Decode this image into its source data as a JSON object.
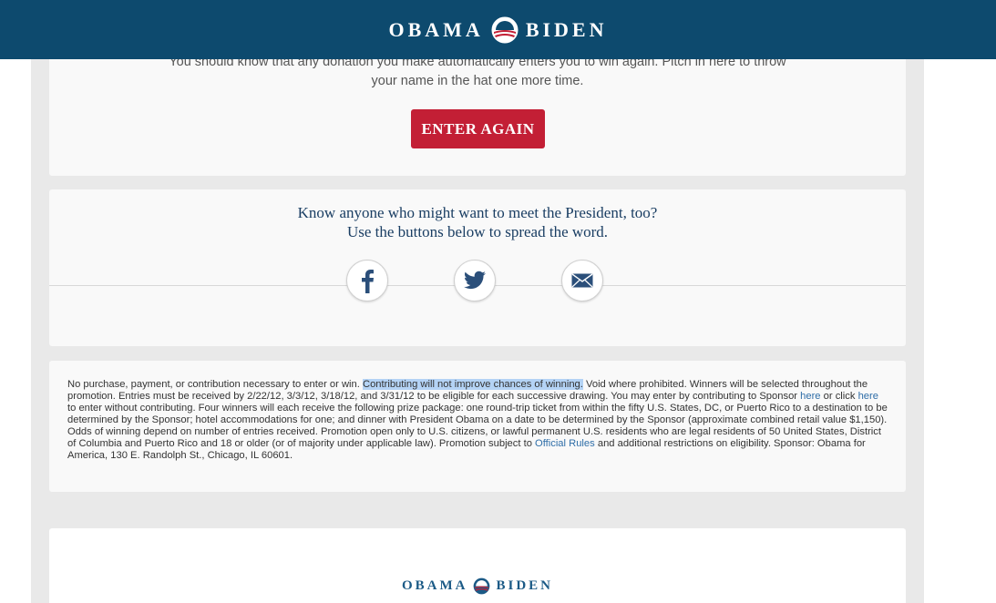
{
  "header": {
    "brand_left": "OBAMA",
    "brand_right": "BIDEN",
    "logo_icon": "obama-logo-icon"
  },
  "enter_panel": {
    "line1": "You should know that any donation you make automatically enters you to win again. Pitch in here to throw",
    "line2": "your name in the hat one more time.",
    "button_label": "ENTER AGAIN"
  },
  "share_panel": {
    "line1": "Know anyone who might want to meet the President, too?",
    "line2": "Use the buttons below to spread the word.",
    "buttons": [
      "facebook-icon",
      "twitter-icon",
      "email-icon"
    ]
  },
  "legal": {
    "part1": "No purchase, payment, or contribution necessary to enter or win. ",
    "highlight": "Contributing will not improve chances of winning.",
    "part2": " Void where prohibited. Winners will be selected throughout the promotion. Entries must be received by 2/22/12, 3/3/12, 3/18/12, and 3/31/12 to be eligible for each successive drawing. You may enter by contributing to Sponsor ",
    "link_here1": "here",
    "part3": " or click ",
    "link_here2": "here",
    "part4": " to enter without contributing. Four winners will each receive the following prize package: one round-trip ticket from within the fifty U.S. States, DC, or Puerto Rico to a destination to be determined by the Sponsor; hotel accommodations for one; and dinner with President Obama on a date to be determined by the Sponsor (approximate combined retail value $1,150). Odds of winning depend on number of entries received. Promotion open only to U.S. citizens, or lawful permanent U.S. residents who are legal residents of 50 United States, District of Columbia and Puerto Rico and 18 or older (or of majority under applicable law). Promotion subject to ",
    "link_rules": "Official Rules",
    "part5": " and additional restrictions on eligibility. Sponsor: Obama for America, 130 E. Randolph St., Chicago, IL 60601."
  },
  "footer": {
    "brand_left": "OBAMA",
    "brand_right": "BIDEN"
  },
  "colors": {
    "header_bg": "#0d4a6e",
    "button_red": "#c31f35",
    "link_blue": "#2f6ea8",
    "highlight": "#b4d3f5"
  }
}
